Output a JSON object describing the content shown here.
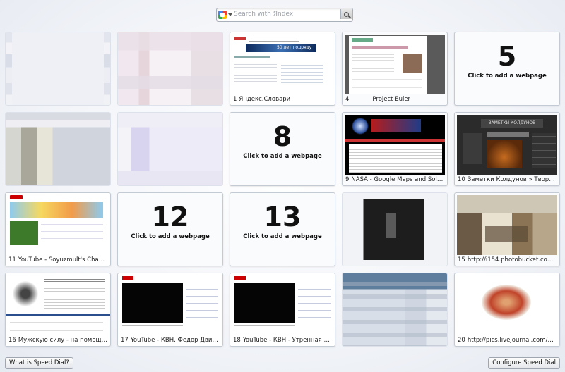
{
  "search": {
    "placeholder": "Search with Яndex",
    "engine_icon": "google-icon"
  },
  "tiles": [
    {
      "kind": "blurred"
    },
    {
      "kind": "blurred"
    },
    {
      "kind": "site",
      "num": "1",
      "title": "Яндекс.Словари",
      "banner": "50 лет подряду"
    },
    {
      "kind": "site",
      "num": "4",
      "title": "Project Euler"
    },
    {
      "kind": "empty",
      "num": "5",
      "cta": "Click to add a webpage"
    },
    {
      "kind": "blurred"
    },
    {
      "kind": "blurred"
    },
    {
      "kind": "empty",
      "num": "8",
      "cta": "Click to add a webpage"
    },
    {
      "kind": "site",
      "num": "9",
      "title": "NASA - Google Maps and Sola…"
    },
    {
      "kind": "site",
      "num": "10",
      "title": "Заметки Колдунов » Твори…",
      "banner": "ЗАМЕТКИ КОЛДУНОВ"
    },
    {
      "kind": "site",
      "num": "11",
      "title": "YouTube - Soyuzmult's Chan…"
    },
    {
      "kind": "empty",
      "num": "12",
      "cta": "Click to add a webpage"
    },
    {
      "kind": "empty",
      "num": "13",
      "cta": "Click to add a webpage"
    },
    {
      "kind": "blurred"
    },
    {
      "kind": "site",
      "num": "15",
      "title": "http://i154.photobucket.com…"
    },
    {
      "kind": "site",
      "num": "16",
      "title": "Мужскую силу - на помощь…"
    },
    {
      "kind": "site",
      "num": "17",
      "title": "YouTube - КВН. Федор Двин…"
    },
    {
      "kind": "site",
      "num": "18",
      "title": "YouTube - КВН - Утренная т…"
    },
    {
      "kind": "blurred"
    },
    {
      "kind": "site",
      "num": "20",
      "title": "http://pics.livejournal.com/m…"
    }
  ],
  "buttons": {
    "what_is": "What is Speed Dial?",
    "configure": "Configure Speed Dial"
  }
}
